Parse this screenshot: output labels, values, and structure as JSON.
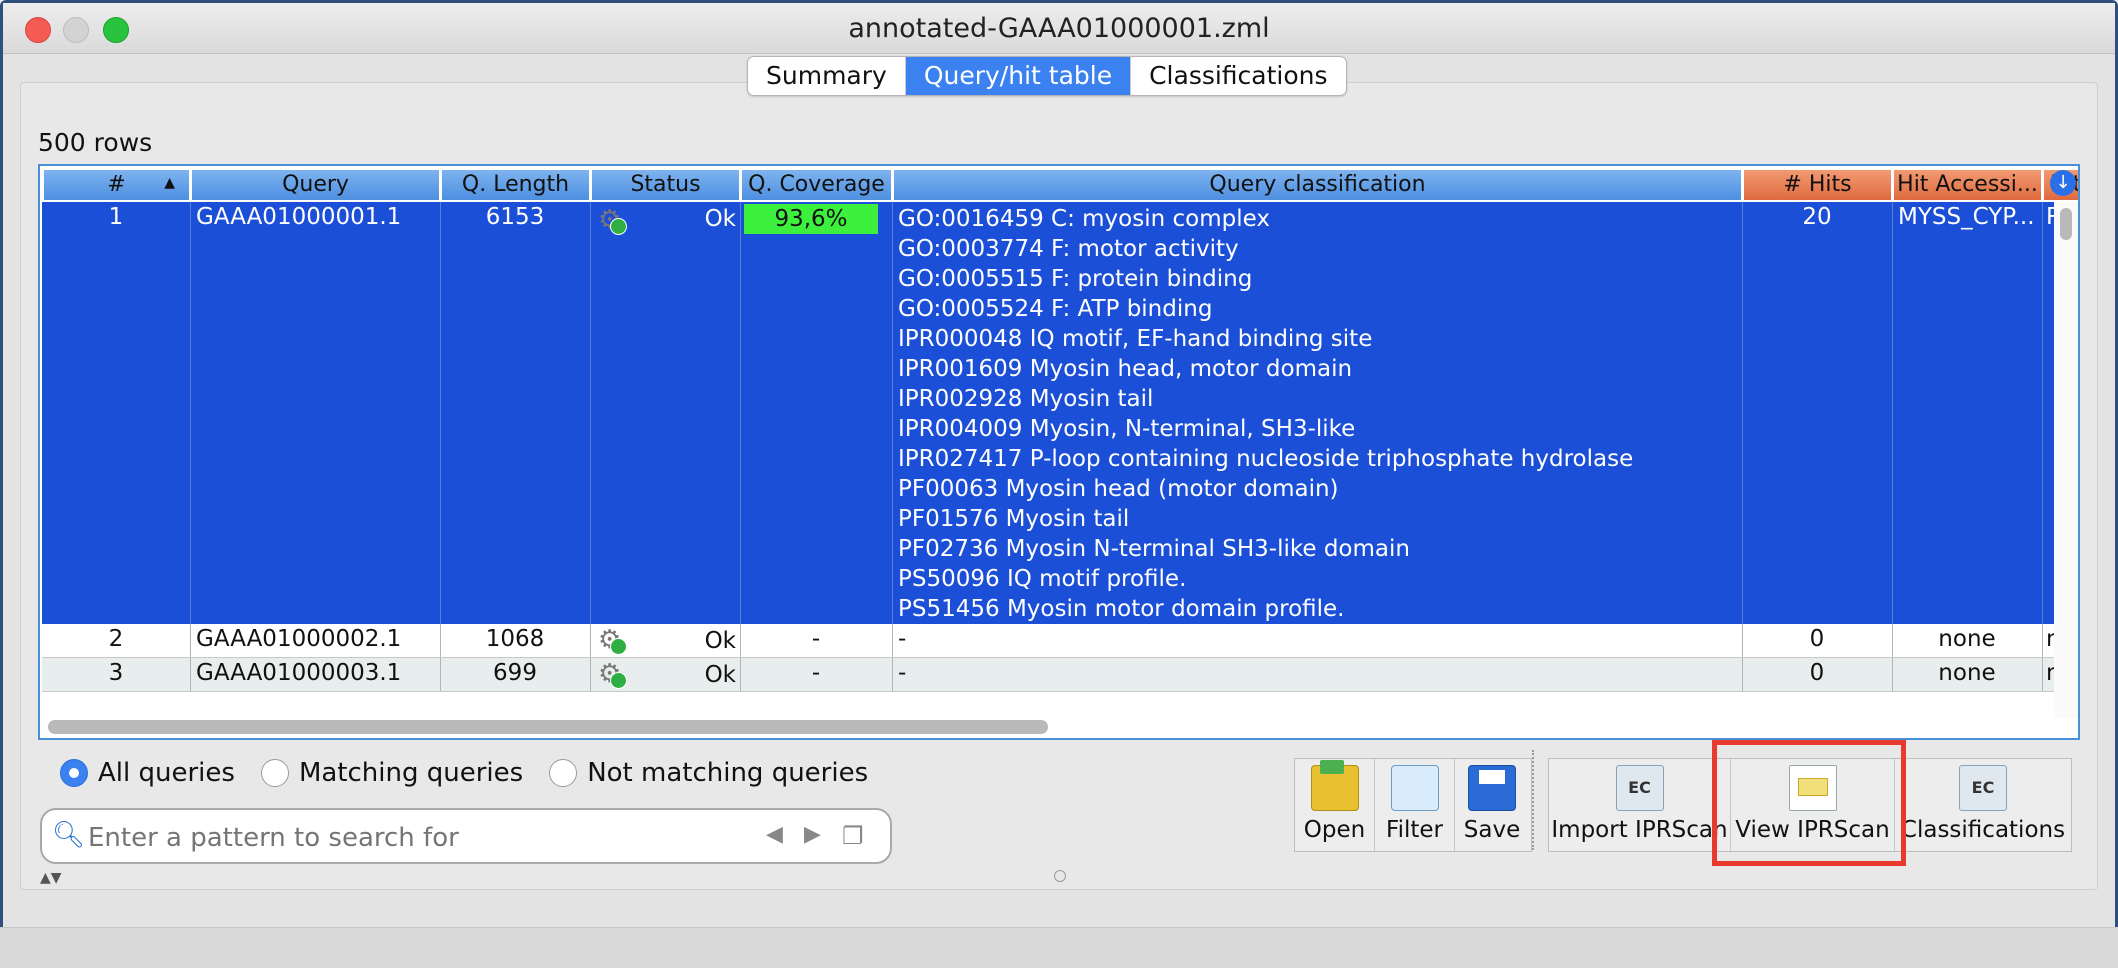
{
  "window": {
    "title": "annotated-GAAA01000001.zml"
  },
  "tabs": [
    {
      "label": "Summary",
      "active": false
    },
    {
      "label": "Query/hit table",
      "active": true
    },
    {
      "label": "Classifications",
      "active": false
    }
  ],
  "table": {
    "row_count_label": "500 rows",
    "columns": [
      "#",
      "Query",
      "Q. Length",
      "Status",
      "Q. Coverage",
      "Query classification",
      "# Hits",
      "Hit Accessi...",
      "Hit"
    ],
    "rows": [
      {
        "num": "1",
        "query": "GAAA01000001.1",
        "length": "6153",
        "status": "Ok",
        "coverage": "93,6%",
        "classification": [
          "GO:0016459 C: myosin complex",
          "GO:0003774 F: motor activity",
          "GO:0005515 F: protein binding",
          "GO:0005524 F: ATP binding",
          "IPR000048 IQ motif, EF-hand binding site",
          "IPR001609 Myosin head, motor domain",
          "IPR002928 Myosin tail",
          "IPR004009 Myosin, N-terminal, SH3-like",
          "IPR027417 P-loop containing nucleoside triphosphate hydrolase",
          "PF00063 Myosin head (motor domain)",
          "PF01576 Myosin tail",
          "PF02736 Myosin N-terminal SH3-like domain",
          "PS50096 IQ motif profile.",
          "PS51456 Myosin motor domain profile."
        ],
        "hits": "20",
        "hit_accession": "MYSS_CYP...",
        "hit_desc": "Rec"
      },
      {
        "num": "2",
        "query": "GAAA01000002.1",
        "length": "1068",
        "status": "Ok",
        "coverage": "-",
        "classification_single": "-",
        "hits": "0",
        "hit_accession": "none",
        "hit_desc": "non"
      },
      {
        "num": "3",
        "query": "GAAA01000003.1",
        "length": "699",
        "status": "Ok",
        "coverage": "-",
        "classification_single": "-",
        "hits": "0",
        "hit_accession": "none",
        "hit_desc": "non"
      }
    ]
  },
  "filters": {
    "all": "All queries",
    "matching": "Matching queries",
    "not_matching": "Not matching queries",
    "selected": "all"
  },
  "search": {
    "placeholder": "Enter a pattern to search for"
  },
  "toolbar": {
    "open": "Open",
    "filter": "Filter",
    "save": "Save",
    "import_iprscan": "Import IPRScan",
    "view_iprscan": "View IPRScan",
    "classifications": "Classifications",
    "ec_label": "EC"
  },
  "colors": {
    "selected_row": "#1b4fd8",
    "header_blue": "#4d8fe0",
    "header_orange": "#e06a3f",
    "coverage_bar": "#3ef03e",
    "highlight": "#e8392d"
  }
}
